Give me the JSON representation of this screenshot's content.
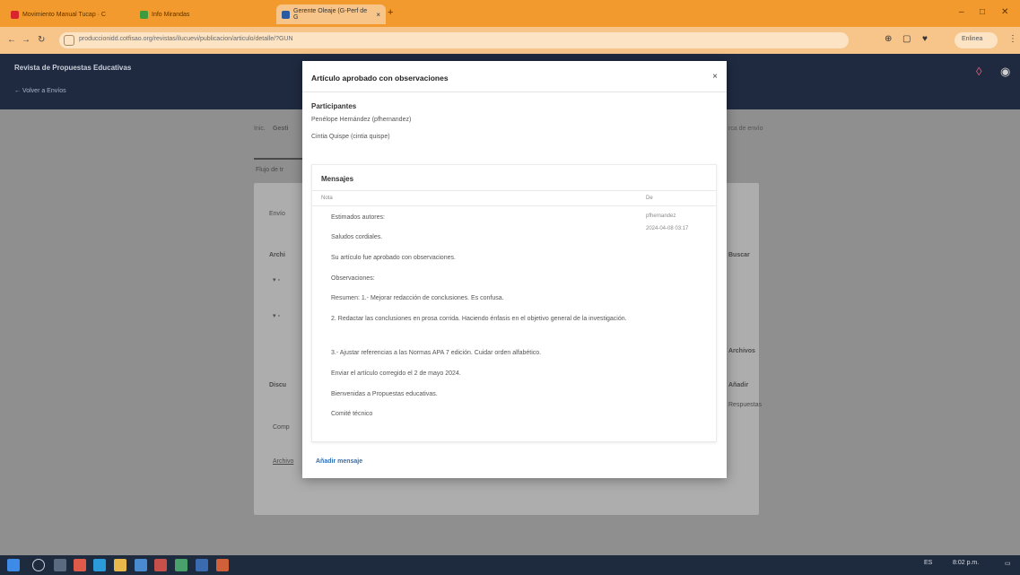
{
  "browser": {
    "tabs": [
      {
        "label": "Movimiento Manual Tucap · C"
      },
      {
        "label": "Info Mirandas"
      },
      {
        "label": "Gerente Oleaje (G-Perf de G"
      }
    ],
    "url": "produccionidd.cotfisao.org/revistas/ilucuevi/publicacion/articulo/detalle/?GUN",
    "profile_label": "Enlinea"
  },
  "app": {
    "title": "Revista de Propuestas Educativas",
    "back_label": "← Volver a Envíos"
  },
  "background": {
    "crumb_left": "Inic.",
    "crumb_bold": "Gesti",
    "crumb_right": "rca de envío",
    "tab_left": "Flujo de tr",
    "sub_left": "Envío",
    "articles_heading": "Archi",
    "actions_right": "Buscar",
    "more_right": "Archivos",
    "discussions_heading": "Discu",
    "add_right": "Añadir",
    "col_right": "Respuestas",
    "link_left": "Comp",
    "link_left2": "Archivo"
  },
  "modal": {
    "title": "Artículo aprobado con observaciones",
    "participants_heading": "Participantes",
    "participants": [
      "Penélope Hernández (pfhernandez)",
      "Cintia Quispe (cintia quispe)"
    ],
    "messages_heading": "Mensajes",
    "col_note": "Nota",
    "col_from": "De",
    "sender": "pfhernandez",
    "date": "2024-04-08 03:17",
    "lines": [
      "Estimados autores:",
      "Saludos cordiales.",
      "Su artículo fue aprobado con observaciones.",
      "Observaciones:",
      "Resumen: 1.- Mejorar redacción de conclusiones. Es confusa.",
      "2. Redactar las conclusiones en prosa corrida. Haciendo énfasis en el objetivo general de la investigación.",
      "3.- Ajustar referencias a las Normas APA 7 edición. Cuidar orden alfabético.",
      "Enviar el artículo corregido el 2 de mayo 2024.",
      "Bienvenidas a Propuestas educativas.",
      "Comité técnico"
    ],
    "add_message": "Añadir mensaje",
    "close_symbol": "×"
  },
  "taskbar": {
    "tray_text": "ES",
    "clock": "8:02 p.m."
  },
  "colors": {
    "browser_tab": "#f29a2e",
    "app_header": "#1f2a40",
    "link": "#2f6fb5"
  }
}
